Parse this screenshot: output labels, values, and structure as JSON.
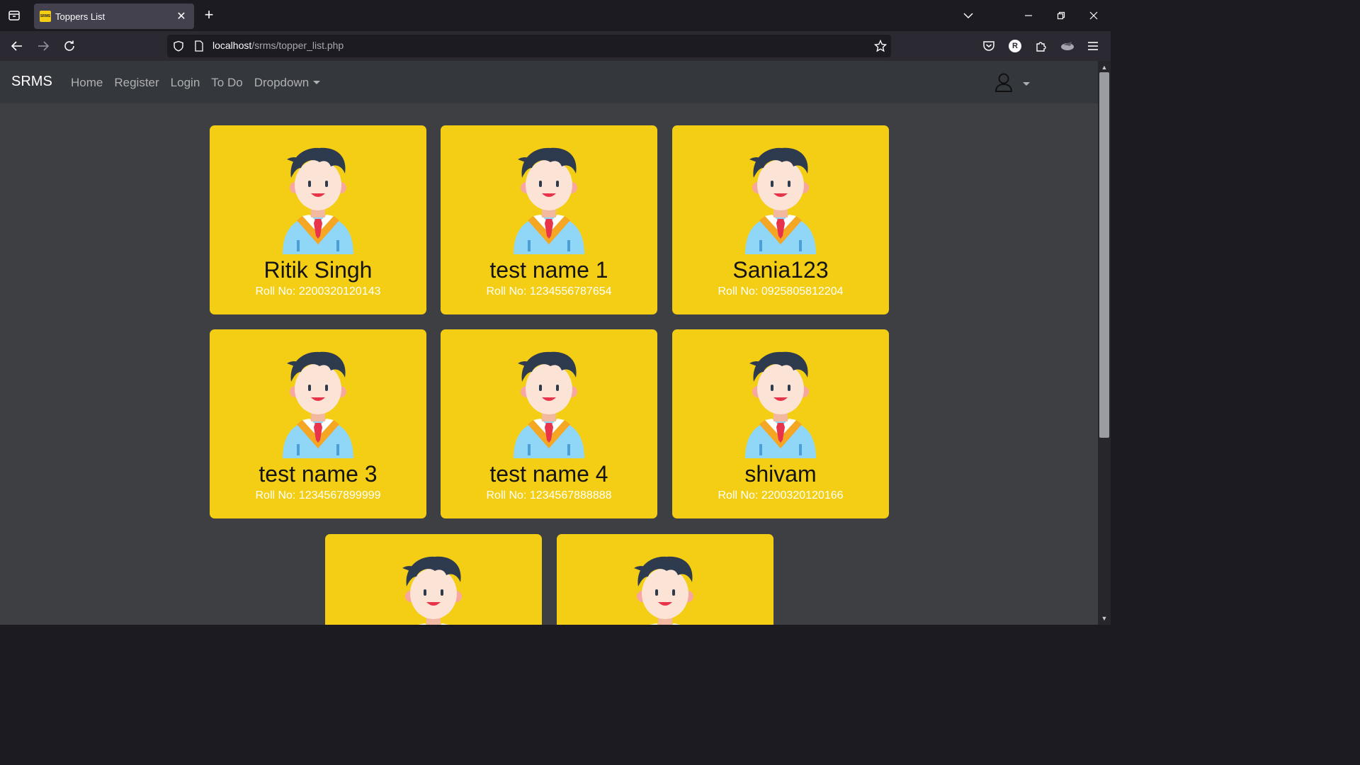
{
  "browser": {
    "tab_title": "Toppers List",
    "favicon_text": "SRMS",
    "url_host": "localhost",
    "url_path": "/srms/topper_list.php",
    "profile_initial": "R"
  },
  "site": {
    "brand": "SRMS",
    "nav": [
      "Home",
      "Register",
      "Login",
      "To Do",
      "Dropdown"
    ]
  },
  "toppers": [
    {
      "name": "Ritik Singh",
      "roll": "Roll No: 2200320120143"
    },
    {
      "name": "test name 1",
      "roll": "Roll No: 1234556787654"
    },
    {
      "name": "Sania123",
      "roll": "Roll No: 0925805812204"
    },
    {
      "name": "test name 3",
      "roll": "Roll No: 1234567899999"
    },
    {
      "name": "test name 4",
      "roll": "Roll No: 1234567888888"
    },
    {
      "name": "shivam",
      "roll": "Roll No: 2200320120166"
    },
    {
      "name": "",
      "roll": ""
    },
    {
      "name": "",
      "roll": ""
    }
  ],
  "colors": {
    "card": "#f4ce14",
    "nav": "#34373c",
    "page": "#3e3f43"
  },
  "icons": [
    "tab-list-icon",
    "close-icon",
    "plus-icon",
    "chevron-down-icon",
    "minimize-icon",
    "restore-icon",
    "back-arrow-icon",
    "forward-arrow-icon",
    "reload-icon",
    "shield-icon",
    "page-icon",
    "star-icon",
    "pocket-icon",
    "extensions-icon",
    "menu-icon",
    "user-icon",
    "student-avatar-icon"
  ]
}
